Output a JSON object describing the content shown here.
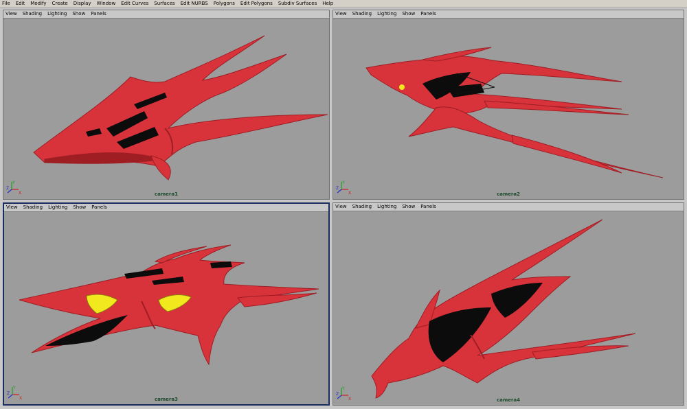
{
  "menubar": {
    "items": [
      "File",
      "Edit",
      "Modify",
      "Create",
      "Display",
      "Window",
      "Edit Curves",
      "Surfaces",
      "Edit NURBS",
      "Polygons",
      "Edit Polygons",
      "Subdiv Surfaces",
      "Help"
    ]
  },
  "panels": [
    {
      "menu": [
        "View",
        "Shading",
        "Lighting",
        "Show",
        "Panels"
      ],
      "camera": "camera1",
      "active": false
    },
    {
      "menu": [
        "View",
        "Shading",
        "Lighting",
        "Show",
        "Panels"
      ],
      "camera": "camera2",
      "active": false
    },
    {
      "menu": [
        "View",
        "Shading",
        "Lighting",
        "Show",
        "Panels"
      ],
      "camera": "camera3",
      "active": true
    },
    {
      "menu": [
        "View",
        "Shading",
        "Lighting",
        "Show",
        "Panels"
      ],
      "camera": "camera4",
      "active": false
    }
  ],
  "axis": {
    "x": "X",
    "y": "Y",
    "z": "Z"
  },
  "colors": {
    "model": "#d8323a",
    "model_dark": "#9e1e24",
    "cockpit": "#f2e81e",
    "intake": "#0c0c0c",
    "viewport_bg": "#9c9c9c",
    "active_border": "#1a2b5e",
    "label": "#1e4a2c",
    "axis_x": "#d21e1e",
    "axis_y": "#1ea01e",
    "axis_z": "#1e2ed2"
  }
}
